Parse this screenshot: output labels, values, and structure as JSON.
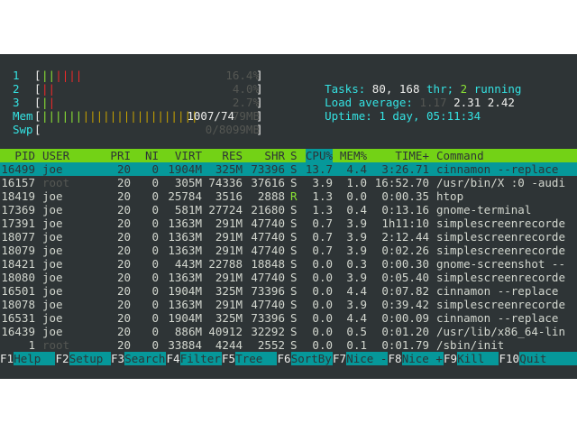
{
  "meters": {
    "cpus": [
      {
        "label": "1",
        "value": "16.4%",
        "bar": [
          [
            "||",
            "green"
          ],
          [
            "||||",
            "red"
          ]
        ]
      },
      {
        "label": "2",
        "value": "4.0%",
        "bar": [
          [
            "||",
            "red"
          ]
        ]
      },
      {
        "label": "3",
        "value": "2.7%",
        "bar": [
          [
            "|",
            "green"
          ],
          [
            "|",
            "red"
          ]
        ]
      }
    ],
    "mem": {
      "label": "Mem",
      "bar": [
        [
          "||||||",
          "green"
        ],
        [
          "|||||||||||||||||",
          "yellow"
        ]
      ],
      "value_text": "1007/74",
      "value_rest": "79MB"
    },
    "swp": {
      "label": "Swp",
      "value_text": "0/8099MB"
    }
  },
  "summary": {
    "tasks_label": "Tasks:",
    "tasks_count": "80,",
    "threads": "168",
    "thr_label": "thr;",
    "running_count": "2",
    "running_label": "running",
    "load_label": "Load average:",
    "load1": "1.17",
    "load5": "2.31",
    "load15": "2.42",
    "uptime_label": "Uptime:",
    "uptime_value": "1 day, 05:11:34"
  },
  "columns": [
    "PID",
    "USER",
    "PRI",
    "NI",
    "VIRT",
    "RES",
    "SHR",
    "S",
    "CPU%",
    "MEM%",
    "TIME+",
    "Command"
  ],
  "rows": [
    {
      "pid": "16499",
      "user": "joe",
      "pri": "20",
      "ni": "0",
      "virt": "1904M",
      "res": "325M",
      "shr": "73396",
      "s": "S",
      "cpu": "13.7",
      "mem": "4.4",
      "time": "3:26.71",
      "cmd": "cinnamon --replace",
      "selected": true
    },
    {
      "pid": "16157",
      "user": "root",
      "pri": "20",
      "ni": "0",
      "virt": "305M",
      "res": "74336",
      "shr": "37616",
      "s": "S",
      "cpu": "3.9",
      "mem": "1.0",
      "time": "16:52.70",
      "cmd": "/usr/bin/X :0 -audi"
    },
    {
      "pid": "18419",
      "user": "joe",
      "pri": "20",
      "ni": "0",
      "virt": "25784",
      "res": "3516",
      "shr": "2888",
      "s": "R",
      "cpu": "1.3",
      "mem": "0.0",
      "time": "0:00.35",
      "cmd": "htop"
    },
    {
      "pid": "17369",
      "user": "joe",
      "pri": "20",
      "ni": "0",
      "virt": "581M",
      "res": "27724",
      "shr": "21680",
      "s": "S",
      "cpu": "1.3",
      "mem": "0.4",
      "time": "0:13.16",
      "cmd": "gnome-terminal"
    },
    {
      "pid": "17391",
      "user": "joe",
      "pri": "20",
      "ni": "0",
      "virt": "1363M",
      "res": "291M",
      "shr": "47740",
      "s": "S",
      "cpu": "0.7",
      "mem": "3.9",
      "time": "1h11:10",
      "cmd": "simplescreenrecorde"
    },
    {
      "pid": "18077",
      "user": "joe",
      "pri": "20",
      "ni": "0",
      "virt": "1363M",
      "res": "291M",
      "shr": "47740",
      "s": "S",
      "cpu": "0.7",
      "mem": "3.9",
      "time": "2:12.44",
      "cmd": "simplescreenrecorde"
    },
    {
      "pid": "18079",
      "user": "joe",
      "pri": "20",
      "ni": "0",
      "virt": "1363M",
      "res": "291M",
      "shr": "47740",
      "s": "S",
      "cpu": "0.7",
      "mem": "3.9",
      "time": "0:02.26",
      "cmd": "simplescreenrecorde"
    },
    {
      "pid": "18421",
      "user": "joe",
      "pri": "20",
      "ni": "0",
      "virt": "443M",
      "res": "22788",
      "shr": "18848",
      "s": "S",
      "cpu": "0.0",
      "mem": "0.3",
      "time": "0:00.30",
      "cmd": "gnome-screenshot --"
    },
    {
      "pid": "18080",
      "user": "joe",
      "pri": "20",
      "ni": "0",
      "virt": "1363M",
      "res": "291M",
      "shr": "47740",
      "s": "S",
      "cpu": "0.0",
      "mem": "3.9",
      "time": "0:05.40",
      "cmd": "simplescreenrecorde"
    },
    {
      "pid": "16501",
      "user": "joe",
      "pri": "20",
      "ni": "0",
      "virt": "1904M",
      "res": "325M",
      "shr": "73396",
      "s": "S",
      "cpu": "0.0",
      "mem": "4.4",
      "time": "0:07.82",
      "cmd": "cinnamon --replace"
    },
    {
      "pid": "18078",
      "user": "joe",
      "pri": "20",
      "ni": "0",
      "virt": "1363M",
      "res": "291M",
      "shr": "47740",
      "s": "S",
      "cpu": "0.0",
      "mem": "3.9",
      "time": "0:39.42",
      "cmd": "simplescreenrecorde"
    },
    {
      "pid": "16531",
      "user": "joe",
      "pri": "20",
      "ni": "0",
      "virt": "1904M",
      "res": "325M",
      "shr": "73396",
      "s": "S",
      "cpu": "0.0",
      "mem": "4.4",
      "time": "0:00.09",
      "cmd": "cinnamon --replace"
    },
    {
      "pid": "16439",
      "user": "joe",
      "pri": "20",
      "ni": "0",
      "virt": "886M",
      "res": "40912",
      "shr": "32292",
      "s": "S",
      "cpu": "0.0",
      "mem": "0.5",
      "time": "0:01.20",
      "cmd": "/usr/lib/x86_64-lin"
    },
    {
      "pid": "1",
      "user": "root",
      "pri": "20",
      "ni": "0",
      "virt": "33884",
      "res": "4244",
      "shr": "2552",
      "s": "S",
      "cpu": "0.0",
      "mem": "0.1",
      "time": "0:01.79",
      "cmd": "/sbin/init"
    }
  ],
  "fkeys": [
    {
      "key": "F1",
      "label": "Help"
    },
    {
      "key": "F2",
      "label": "Setup"
    },
    {
      "key": "F3",
      "label": "Search"
    },
    {
      "key": "F4",
      "label": "Filter"
    },
    {
      "key": "F5",
      "label": "Tree"
    },
    {
      "key": "F6",
      "label": "SortBy"
    },
    {
      "key": "F7",
      "label": "Nice -"
    },
    {
      "key": "F8",
      "label": "Nice +"
    },
    {
      "key": "F9",
      "label": "Kill"
    },
    {
      "key": "F10",
      "label": "Quit"
    }
  ],
  "colors": {
    "background": "#2e3436",
    "header": "#73d216",
    "selection": "#06989a",
    "cyan": "#34e2e2",
    "green": "#8ae234",
    "red": "#ef2929",
    "yellow": "#c4a000"
  }
}
